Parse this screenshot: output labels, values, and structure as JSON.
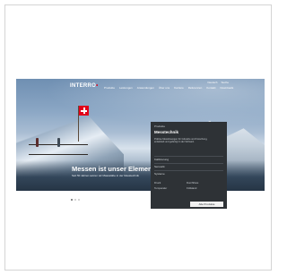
{
  "header": {
    "logo": "INTERRO",
    "nav_items": [
      "Produkte",
      "Leistungen",
      "Anwendungen",
      "Über uns",
      "Karriere",
      "Referenzen",
      "Kontakt",
      "Downloads"
    ],
    "top_links": [
      "Deutsch",
      "Suche"
    ]
  },
  "hero": {
    "headline": "Messen ist unser Element.",
    "subline": "Seit 50 Jahren setzen wir Massstäbe in der Messtechnik"
  },
  "menu": {
    "top_label": "Produkte",
    "title": "Messtechnik",
    "description": "Präzise Messlösungen für Industrie und Forschung, entwickelt und gefertigt in der Schweiz.",
    "rows": [
      "Kalibrierung",
      "Sensorik",
      "Systeme"
    ],
    "col_left": [
      "Druck",
      "Temperatur"
    ],
    "col_right": [
      "Durchfluss",
      "Füllstand"
    ],
    "button_label": "Alle Produkte"
  },
  "colors": {
    "accent": "#e2001a",
    "menu_bg": "#2e3236"
  }
}
